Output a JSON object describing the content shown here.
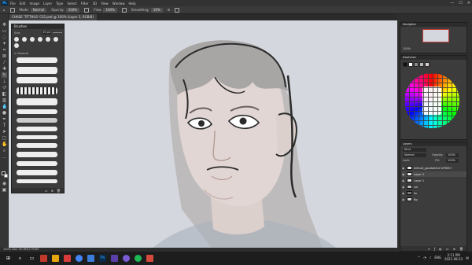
{
  "menu": [
    "File",
    "Edit",
    "Image",
    "Layer",
    "Type",
    "Select",
    "Filter",
    "3D",
    "View",
    "Window",
    "Help"
  ],
  "window_controls": [
    "—",
    "☐",
    "✕"
  ],
  "options": {
    "mode_label": "Mode:",
    "mode_value": "Normal",
    "opacity_label": "Opacity:",
    "opacity_value": "100%",
    "flow_label": "Flow:",
    "flow_value": "100%",
    "smoothing_label": "Smoothing:",
    "smoothing_value": "10%"
  },
  "document_tab": "CHASE 'TITTHUS' CS2.psd @ 100% (Layer 2, RGB/8)",
  "status": "100%   Doc: 60.6M/179.8M",
  "brushes_panel": {
    "title": "Brushes",
    "size_label": "Size:",
    "size_value": "15 px",
    "folder": "> General"
  },
  "navigator_tab": "Navigator",
  "navigator_zoom": "100%",
  "swatches_tab": "Swatches",
  "layers": {
    "tab": "Layers",
    "kind": "Kind",
    "mode": "Normal",
    "opacity_label": "Opacity:",
    "opacity_value": "100%",
    "lock_label": "Lock:",
    "fill_label": "Fill:",
    "fill_value": "100%",
    "items": [
      "default_goodomlee’sFRSB+",
      "Layer 2",
      "Layer 1",
      "col",
      "lin",
      "Bg"
    ]
  },
  "clock": {
    "time": "2:11 PM",
    "date": "2021-08-23"
  },
  "tray_lang": "ENG",
  "colors": {
    "canvas": "#d4d7dd",
    "accent": "#31a8ff",
    "chrome": "#2b2b2b"
  }
}
